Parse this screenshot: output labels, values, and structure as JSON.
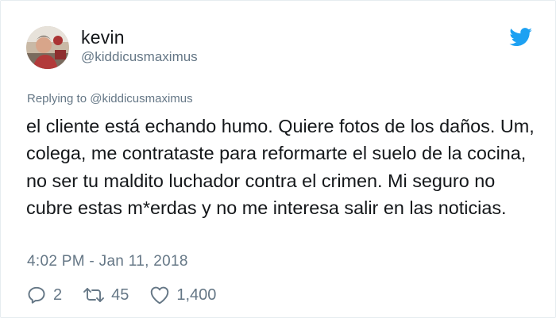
{
  "user": {
    "display_name": "kevin",
    "handle": "@kiddicusmaximus"
  },
  "reply": {
    "text": "Replying to @kiddicusmaximus"
  },
  "tweet": {
    "text": "el cliente está echando humo. Quiere fotos de los daños. Um, colega, me contrataste para reformarte el suelo de la cocina, no ser tu maldito luchador contra el crimen. Mi seguro no cubre estas m*erdas y no me interesa salir en las noticias.",
    "timestamp": "4:02 PM - Jan 11, 2018"
  },
  "actions": {
    "replies": "2",
    "retweets": "45",
    "likes": "1,400"
  },
  "icons": {
    "avatar": "profile-photo",
    "brand": "twitter-bird-icon",
    "reply": "reply-bubble-icon",
    "retweet": "retweet-arrows-icon",
    "like": "heart-icon"
  },
  "colors": {
    "brand": "#1da1f2",
    "secondary_text": "#657786",
    "primary_text": "#14171a"
  }
}
